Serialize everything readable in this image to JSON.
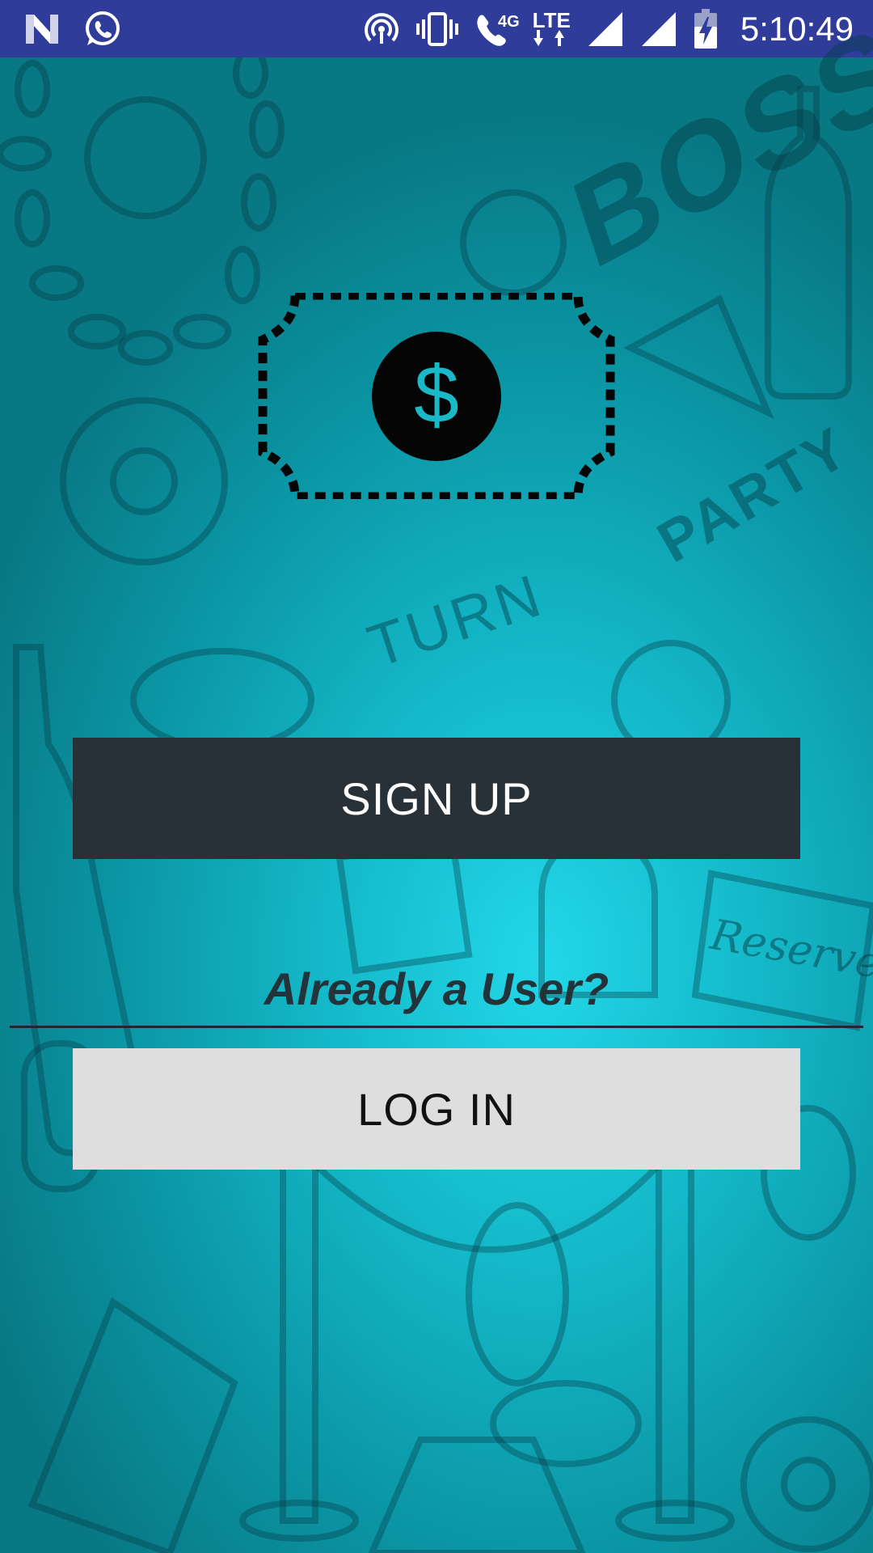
{
  "status_bar": {
    "time": "5:10:49",
    "network_type": "4G",
    "lte_label": "LTE",
    "left_icons": [
      "n-notification-icon",
      "whatsapp-icon"
    ],
    "right_icons": [
      "hotspot-icon",
      "vibrate-icon",
      "wifi-call-icon",
      "lte-icon",
      "signal-icon",
      "signal-icon",
      "battery-charging-icon"
    ],
    "background_color": "#2f3c9a"
  },
  "background": {
    "doodle_words": {
      "boss": "BOSS",
      "party": "PARTY",
      "turn": "TURN",
      "reserved": "Reserved"
    },
    "color_primary": "#14b9c9"
  },
  "logo": {
    "icon": "dollar-ticket-icon",
    "symbol": "$"
  },
  "signup": {
    "label": "SIGN UP",
    "background_color": "#283038"
  },
  "login_prompt": {
    "text": "Already a User?"
  },
  "login": {
    "label": "LOG IN",
    "background_color": "#dedede"
  }
}
